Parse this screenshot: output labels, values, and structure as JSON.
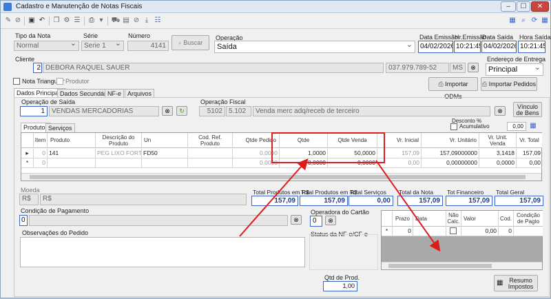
{
  "window": {
    "title": "Cadastro e Manutenção de Notas Fiscais",
    "min": "–",
    "max": "☐",
    "close": "✕"
  },
  "header": {
    "tipo_label": "Tipo da Nota",
    "tipo_value": "Normal",
    "serie_label": "Série",
    "serie_value": "Serie 1",
    "numero_label": "Número",
    "numero_value": "4141",
    "buscar_label": "Buscar",
    "operacao_label": "Operação",
    "operacao_value": "Saída",
    "data_emissao_label": "Data Emissão",
    "data_emissao_value": "04/02/2026",
    "hr_emissao_label": "Hr.Emissão",
    "hr_emissao_value": "10:21:45",
    "data_saida_label": "Data Saída",
    "data_saida_value": "04/02/2026",
    "hora_saida_label": "Hora Saída",
    "hora_saida_value": "10:21:45"
  },
  "cliente": {
    "label": "Cliente",
    "codigo": "2",
    "nome": "DEBORA RAQUEL SAUER",
    "cpf": "037.979.789-52",
    "uf": "MS",
    "endereco_label": "Endereço de Entrega",
    "endereco_value": "Principal"
  },
  "checks": {
    "triangular": "Nota Triangular",
    "produtor": "Produtor"
  },
  "buttons": {
    "importar_odms": "Importar ODMs",
    "importar_pedidos": "Importar Pedidos",
    "vinculo": "Vínculo de Bens",
    "resumo": "Resumo Impostos"
  },
  "tabs": [
    "Dados Principais",
    "Dados Secundários",
    "NF-e",
    "Arquivos"
  ],
  "operacao_saida": {
    "label": "Operação de Saída",
    "codigo": "1",
    "nome": "VENDAS MERCADORIAS"
  },
  "operacao_fiscal": {
    "label": "Operação Fiscal",
    "cfop1": "5102",
    "cfop2": "5.102",
    "descricao": "Venda merc adq/receb de terceiro"
  },
  "subtabs": [
    "Produtos",
    "Serviços"
  ],
  "desconto": {
    "label": "Desconto %",
    "acumulativo": "Acumulativo",
    "value": "0,00"
  },
  "grid": {
    "columns": [
      "Item",
      "Produto",
      "Descrição do Produto",
      "Un",
      "Cod. Ref. Produto",
      "Qtde Pedido",
      "Qtde",
      "Qtde Venda",
      "Vr. Inicial",
      "Vr. Unitário",
      "Vr. Unit. Venda",
      "Vr. Total"
    ],
    "rows": [
      {
        "marker": "▸",
        "item": "0",
        "produto": "141",
        "descricao": "PEG LIXO FORT...",
        "un": "FD50",
        "cod_ref": "",
        "qtde_pedido": "0,0000",
        "qtde": "1,0000",
        "qtde_venda": "50,0000",
        "vr_inicial": "157,09",
        "vr_unitario": "157,09000000",
        "vr_unit_venda": "3,1418",
        "vr_total": "157,09"
      },
      {
        "marker": "*",
        "item": "0",
        "produto": "",
        "descricao": "",
        "un": "",
        "cod_ref": "",
        "qtde_pedido": "0,0000",
        "qtde": "0,0000",
        "qtde_venda": "0,0000",
        "vr_inicial": "0,00",
        "vr_unitario": "0,00000000",
        "vr_unit_venda": "0,0000",
        "vr_total": "0,00"
      }
    ]
  },
  "moeda": {
    "label": "Moeda",
    "simbolo": "R$",
    "nome": "R$"
  },
  "totais": [
    {
      "label": "Total Produtos em R$",
      "value": "157,09"
    },
    {
      "label": "Total Produtos em R$",
      "value": "157,09"
    },
    {
      "label": "Total Serviços",
      "value": "0,00"
    },
    {
      "label": "Total da Nota",
      "value": "157,09"
    },
    {
      "label": "Tot Financeiro",
      "value": "157,09"
    },
    {
      "label": "Total Geral",
      "value": "157,09"
    }
  ],
  "condicao": {
    "label": "Condição de Pagamento",
    "value": "0"
  },
  "operadora": {
    "label": "Operadora do Cartão",
    "value": "0"
  },
  "observacoes": {
    "label": "Observações do Pedido"
  },
  "status": {
    "label": "Status da NF-e/CF-e"
  },
  "qtd_prod": {
    "label": "Qtd de Prod.",
    "value": "1,00"
  },
  "parcelas": {
    "columns": [
      "Prazo",
      "Data",
      "Não Calc.",
      "Valor",
      "Cod.",
      "Condição de Pagto"
    ],
    "row": {
      "marker": "*",
      "prazo": "0",
      "valor": "0,00",
      "cod": "0"
    }
  },
  "colors": {
    "accent": "#3a63c9",
    "highlight": "#e01b1b"
  }
}
